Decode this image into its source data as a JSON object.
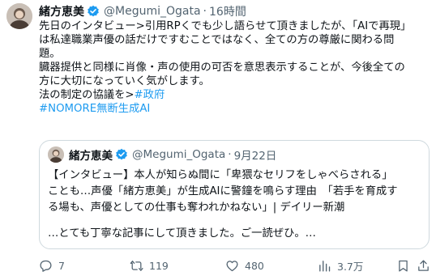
{
  "tweet": {
    "author_name": "緒方恵美",
    "handle": "@Megumi_Ogata",
    "separator": "·",
    "time": "16時間",
    "lines": [
      "先日のインタビュー>引用RPくでも少し語らせて頂きましたが、「AIで再現」",
      "は私達職業声優の話だけですむことではなく、全ての方の尊厳に関わる問",
      "題。",
      "臓器提供と同様に肖像・声の使用の可否を意思表示することが、今後全ての",
      "方に大切になっていく気がします。"
    ],
    "last_line_text": "法の制定の協議を>",
    "last_line_link": "#政府",
    "hashtag_line": "#NOMORE無断生成AI"
  },
  "quote": {
    "author_name": "緒方恵美",
    "handle": "@Megumi_Ogata",
    "separator": "·",
    "date": "9月22日",
    "lines": [
      "【インタビュー】本人が知らぬ間に「卑猥なセリフをしゃべらされる」",
      "ことも…声優「緒方恵美」が生成AIに警鐘を鳴らす理由　「若手を育成す",
      "る場も、声優としての仕事も奪われかねない」| デイリー新潮"
    ],
    "footer_line": "…とても丁寧な記事にして頂きました。ご一読ぜひ。…"
  },
  "actions": {
    "reply_count": "7",
    "retweet_count": "119",
    "like_count": "480",
    "view_count": "3.7万",
    "icons": [
      "reply-icon",
      "retweet-icon",
      "like-icon",
      "views-icon",
      "bookmark-icon",
      "share-icon"
    ]
  },
  "colors": {
    "text": "#0f1419",
    "secondary": "#536471",
    "link": "#1d9bf0",
    "border": "#cfd9de",
    "verified": "#1d9bf0"
  }
}
